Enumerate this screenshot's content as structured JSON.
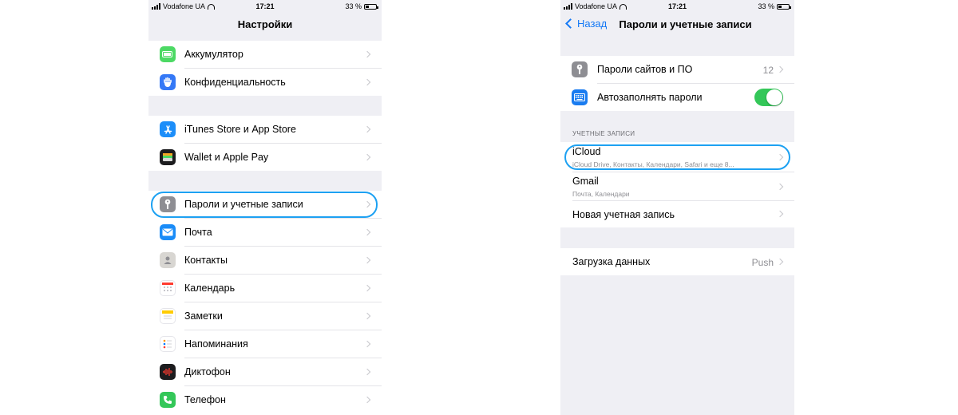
{
  "status_bar": {
    "carrier": "Vodafone UA",
    "time": "17:21",
    "battery": "33 %"
  },
  "left_screen": {
    "title": "Настройки",
    "items": {
      "battery": "Аккумулятор",
      "privacy": "Конфиденциальность",
      "itunes": "iTunes Store и App Store",
      "wallet": "Wallet и Apple Pay",
      "passwords": "Пароли и учетные записи",
      "mail": "Почта",
      "contacts": "Контакты",
      "calendar": "Календарь",
      "notes": "Заметки",
      "reminders": "Напоминания",
      "voice_memos": "Диктофон",
      "phone": "Телефон"
    }
  },
  "right_screen": {
    "back_label": "Назад",
    "title": "Пароли и учетные записи",
    "site_passwords": {
      "label": "Пароли сайтов и ПО",
      "count": "12"
    },
    "autofill": {
      "label": "Автозаполнять пароли",
      "enabled": true
    },
    "accounts_header": "УЧЕТНЫЕ ЗАПИСИ",
    "accounts": {
      "icloud": {
        "name": "iCloud",
        "detail": "iCloud Drive, Контакты, Календари, Safari и еще 8..."
      },
      "gmail": {
        "name": "Gmail",
        "detail": "Почта, Календари"
      }
    },
    "add_account": "Новая учетная запись",
    "fetch": {
      "label": "Загрузка данных",
      "value": "Push"
    }
  },
  "colors": {
    "accent": "#1378f5",
    "highlight": "#1da1f2",
    "toggle_on": "#34c759",
    "group_bg": "#efeff4"
  }
}
